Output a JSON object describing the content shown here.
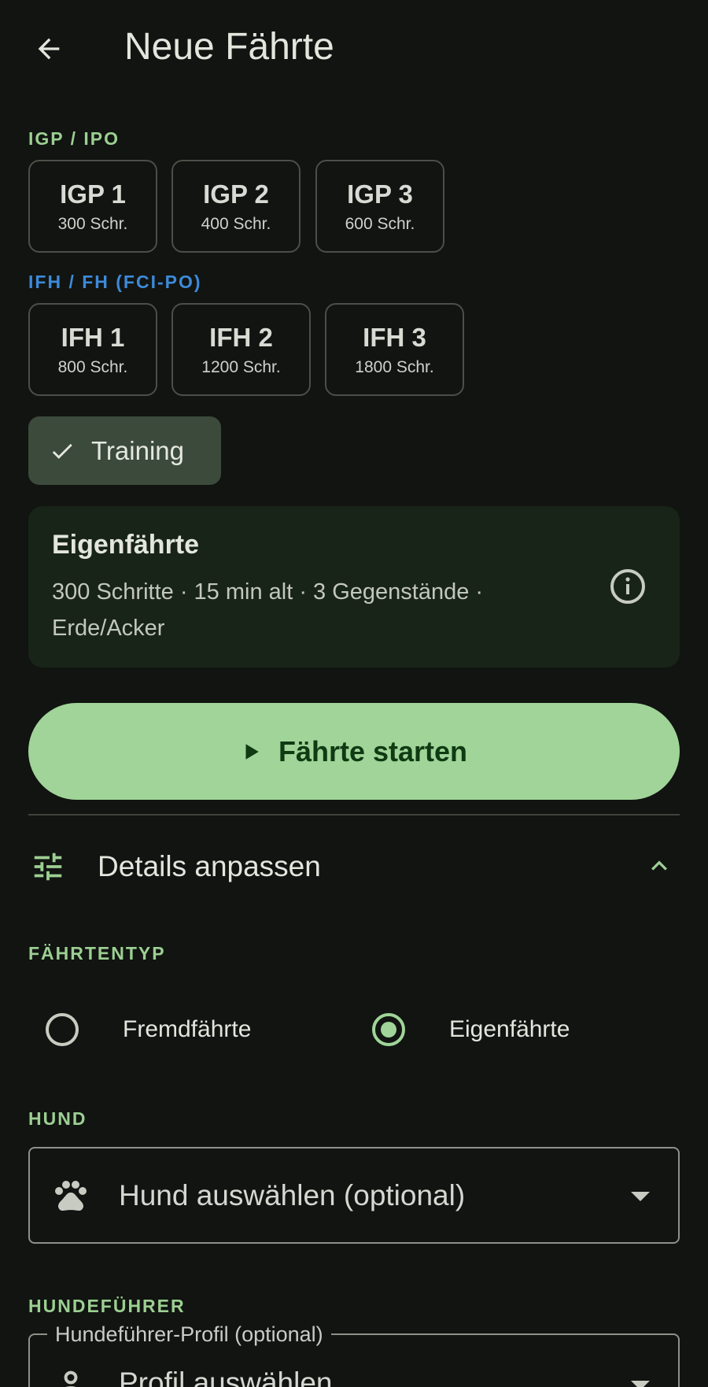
{
  "appbar": {
    "title": "Neue Fährte",
    "back_icon": "arrow-back-icon"
  },
  "igp_section": {
    "label": "IGP / IPO",
    "chips": [
      {
        "title": "IGP 1",
        "sub": "300 Schr."
      },
      {
        "title": "IGP 2",
        "sub": "400 Schr."
      },
      {
        "title": "IGP 3",
        "sub": "600 Schr."
      }
    ]
  },
  "ifh_section": {
    "label": "IFH / FH (FCI-PO)",
    "chips": [
      {
        "title": "IFH 1",
        "sub": "800 Schr."
      },
      {
        "title": "IFH 2",
        "sub": "1200 Schr."
      },
      {
        "title": "IFH 3",
        "sub": "1800 Schr."
      }
    ]
  },
  "training_chip": {
    "label": "Training",
    "selected": true
  },
  "info_card": {
    "title": "Eigenfährte",
    "description": "300 Schritte · 15 min alt · 3 Gegenstände · Erde/Acker"
  },
  "start_button": {
    "label": "Fährte starten"
  },
  "details": {
    "label": "Details anpassen",
    "expanded": true
  },
  "faehrtentyp": {
    "label": "FÄHRTENTYP",
    "options": [
      {
        "label": "Fremdfährte",
        "selected": false
      },
      {
        "label": "Eigenfährte",
        "selected": true
      }
    ]
  },
  "hund": {
    "label": "HUND",
    "value": "Hund auswählen (optional)"
  },
  "hundefuehrer": {
    "label": "HUNDEFÜHRER",
    "field_label": "Hundeführer-Profil (optional)",
    "value": "Profil auswählen"
  },
  "colors": {
    "background": "#111411",
    "accent_green": "#a0d498",
    "label_green": "#9ccf92",
    "label_blue": "#3d8ad9",
    "card_bg": "#182417",
    "chip_selected_bg": "#3c4a3b"
  }
}
